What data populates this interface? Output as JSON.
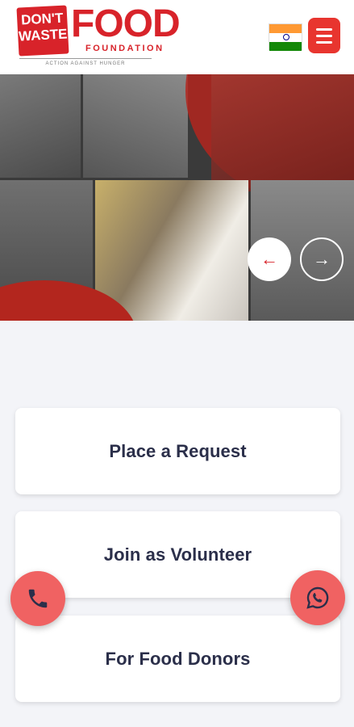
{
  "header": {
    "logo": {
      "dont": "DON'T",
      "waste": "WASTE",
      "food": "FOOD",
      "foundation": "FOUNDATION",
      "tagline": "ACTION AGAINST HUNGER"
    },
    "language_flag": "india-flag-icon",
    "menu_icon": "hamburger-menu-icon"
  },
  "hero": {
    "prev_icon": "arrow-left-icon",
    "next_icon": "arrow-right-icon",
    "prev_glyph": "←",
    "next_glyph": "→"
  },
  "actions": [
    {
      "label": "Place a Request"
    },
    {
      "label": "Join as Volunteer"
    },
    {
      "label": "For Food Donors"
    }
  ],
  "floating": {
    "call_icon": "phone-icon",
    "whatsapp_icon": "whatsapp-icon"
  },
  "colors": {
    "brand_red": "#d8232a",
    "fab_red": "#f06262",
    "card_text": "#2b2f4a"
  }
}
